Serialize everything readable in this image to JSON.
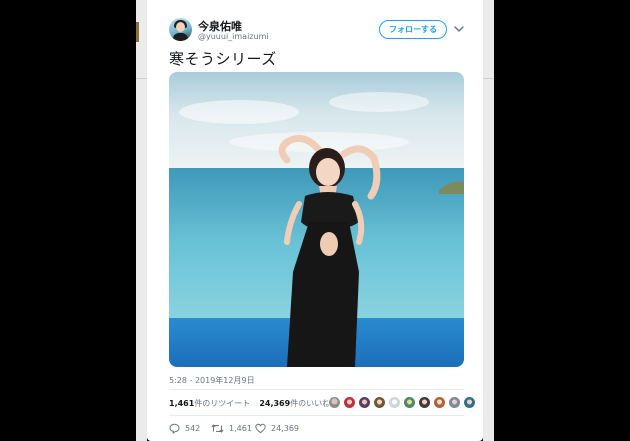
{
  "tweet": {
    "display_name": "今泉佑唯",
    "handle": "@yuuui_imaizumi",
    "follow_label": "フォローする",
    "text": "寒そうシリーズ",
    "timestamp": "5:28 - 2019年12月9日",
    "retweet_count": "1,461",
    "retweet_label": "件のリツイート",
    "like_count": "24,369",
    "like_label": "件のいいね",
    "actions": {
      "reply_count": "542",
      "retweet_count": "1,461",
      "like_count": "24,369"
    }
  },
  "icons": {
    "more": "chevron-down-icon",
    "reply": "reply-icon",
    "retweet": "retweet-icon",
    "like": "heart-icon"
  },
  "colors": {
    "accent": "#1da1f2",
    "text": "#14171a",
    "muted": "#657786",
    "backdrop": "#000000"
  }
}
